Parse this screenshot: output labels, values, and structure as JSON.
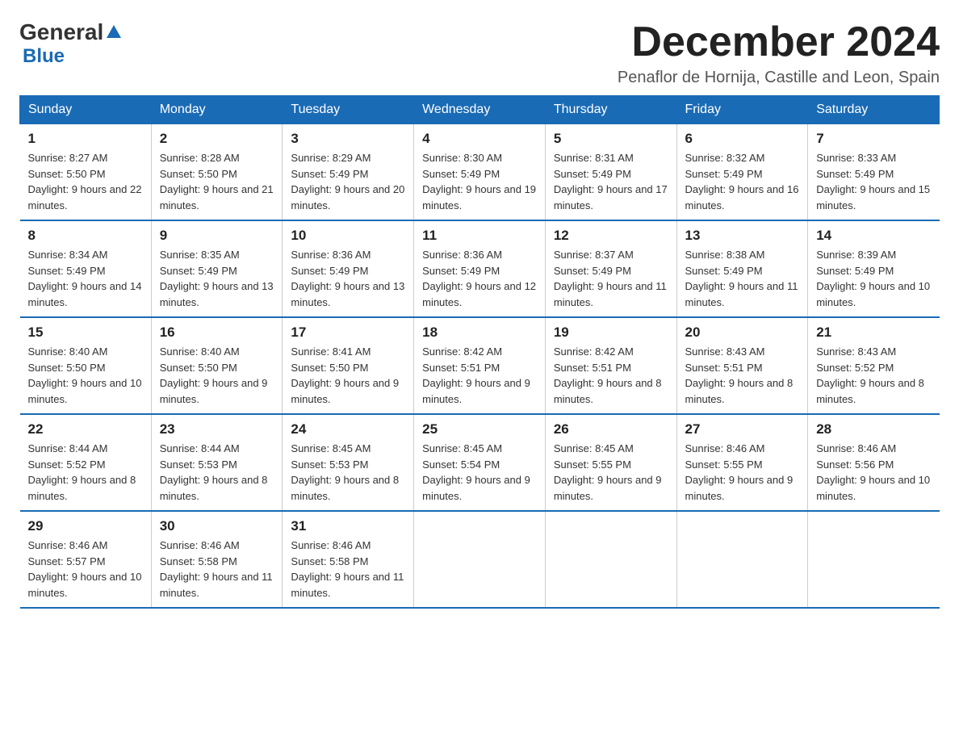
{
  "logo": {
    "general": "General",
    "blue": "Blue"
  },
  "title": {
    "month_year": "December 2024",
    "location": "Penaflor de Hornija, Castille and Leon, Spain"
  },
  "days_of_week": [
    "Sunday",
    "Monday",
    "Tuesday",
    "Wednesday",
    "Thursday",
    "Friday",
    "Saturday"
  ],
  "weeks": [
    [
      {
        "day": "1",
        "sunrise": "Sunrise: 8:27 AM",
        "sunset": "Sunset: 5:50 PM",
        "daylight": "Daylight: 9 hours and 22 minutes."
      },
      {
        "day": "2",
        "sunrise": "Sunrise: 8:28 AM",
        "sunset": "Sunset: 5:50 PM",
        "daylight": "Daylight: 9 hours and 21 minutes."
      },
      {
        "day": "3",
        "sunrise": "Sunrise: 8:29 AM",
        "sunset": "Sunset: 5:49 PM",
        "daylight": "Daylight: 9 hours and 20 minutes."
      },
      {
        "day": "4",
        "sunrise": "Sunrise: 8:30 AM",
        "sunset": "Sunset: 5:49 PM",
        "daylight": "Daylight: 9 hours and 19 minutes."
      },
      {
        "day": "5",
        "sunrise": "Sunrise: 8:31 AM",
        "sunset": "Sunset: 5:49 PM",
        "daylight": "Daylight: 9 hours and 17 minutes."
      },
      {
        "day": "6",
        "sunrise": "Sunrise: 8:32 AM",
        "sunset": "Sunset: 5:49 PM",
        "daylight": "Daylight: 9 hours and 16 minutes."
      },
      {
        "day": "7",
        "sunrise": "Sunrise: 8:33 AM",
        "sunset": "Sunset: 5:49 PM",
        "daylight": "Daylight: 9 hours and 15 minutes."
      }
    ],
    [
      {
        "day": "8",
        "sunrise": "Sunrise: 8:34 AM",
        "sunset": "Sunset: 5:49 PM",
        "daylight": "Daylight: 9 hours and 14 minutes."
      },
      {
        "day": "9",
        "sunrise": "Sunrise: 8:35 AM",
        "sunset": "Sunset: 5:49 PM",
        "daylight": "Daylight: 9 hours and 13 minutes."
      },
      {
        "day": "10",
        "sunrise": "Sunrise: 8:36 AM",
        "sunset": "Sunset: 5:49 PM",
        "daylight": "Daylight: 9 hours and 13 minutes."
      },
      {
        "day": "11",
        "sunrise": "Sunrise: 8:36 AM",
        "sunset": "Sunset: 5:49 PM",
        "daylight": "Daylight: 9 hours and 12 minutes."
      },
      {
        "day": "12",
        "sunrise": "Sunrise: 8:37 AM",
        "sunset": "Sunset: 5:49 PM",
        "daylight": "Daylight: 9 hours and 11 minutes."
      },
      {
        "day": "13",
        "sunrise": "Sunrise: 8:38 AM",
        "sunset": "Sunset: 5:49 PM",
        "daylight": "Daylight: 9 hours and 11 minutes."
      },
      {
        "day": "14",
        "sunrise": "Sunrise: 8:39 AM",
        "sunset": "Sunset: 5:49 PM",
        "daylight": "Daylight: 9 hours and 10 minutes."
      }
    ],
    [
      {
        "day": "15",
        "sunrise": "Sunrise: 8:40 AM",
        "sunset": "Sunset: 5:50 PM",
        "daylight": "Daylight: 9 hours and 10 minutes."
      },
      {
        "day": "16",
        "sunrise": "Sunrise: 8:40 AM",
        "sunset": "Sunset: 5:50 PM",
        "daylight": "Daylight: 9 hours and 9 minutes."
      },
      {
        "day": "17",
        "sunrise": "Sunrise: 8:41 AM",
        "sunset": "Sunset: 5:50 PM",
        "daylight": "Daylight: 9 hours and 9 minutes."
      },
      {
        "day": "18",
        "sunrise": "Sunrise: 8:42 AM",
        "sunset": "Sunset: 5:51 PM",
        "daylight": "Daylight: 9 hours and 9 minutes."
      },
      {
        "day": "19",
        "sunrise": "Sunrise: 8:42 AM",
        "sunset": "Sunset: 5:51 PM",
        "daylight": "Daylight: 9 hours and 8 minutes."
      },
      {
        "day": "20",
        "sunrise": "Sunrise: 8:43 AM",
        "sunset": "Sunset: 5:51 PM",
        "daylight": "Daylight: 9 hours and 8 minutes."
      },
      {
        "day": "21",
        "sunrise": "Sunrise: 8:43 AM",
        "sunset": "Sunset: 5:52 PM",
        "daylight": "Daylight: 9 hours and 8 minutes."
      }
    ],
    [
      {
        "day": "22",
        "sunrise": "Sunrise: 8:44 AM",
        "sunset": "Sunset: 5:52 PM",
        "daylight": "Daylight: 9 hours and 8 minutes."
      },
      {
        "day": "23",
        "sunrise": "Sunrise: 8:44 AM",
        "sunset": "Sunset: 5:53 PM",
        "daylight": "Daylight: 9 hours and 8 minutes."
      },
      {
        "day": "24",
        "sunrise": "Sunrise: 8:45 AM",
        "sunset": "Sunset: 5:53 PM",
        "daylight": "Daylight: 9 hours and 8 minutes."
      },
      {
        "day": "25",
        "sunrise": "Sunrise: 8:45 AM",
        "sunset": "Sunset: 5:54 PM",
        "daylight": "Daylight: 9 hours and 9 minutes."
      },
      {
        "day": "26",
        "sunrise": "Sunrise: 8:45 AM",
        "sunset": "Sunset: 5:55 PM",
        "daylight": "Daylight: 9 hours and 9 minutes."
      },
      {
        "day": "27",
        "sunrise": "Sunrise: 8:46 AM",
        "sunset": "Sunset: 5:55 PM",
        "daylight": "Daylight: 9 hours and 9 minutes."
      },
      {
        "day": "28",
        "sunrise": "Sunrise: 8:46 AM",
        "sunset": "Sunset: 5:56 PM",
        "daylight": "Daylight: 9 hours and 10 minutes."
      }
    ],
    [
      {
        "day": "29",
        "sunrise": "Sunrise: 8:46 AM",
        "sunset": "Sunset: 5:57 PM",
        "daylight": "Daylight: 9 hours and 10 minutes."
      },
      {
        "day": "30",
        "sunrise": "Sunrise: 8:46 AM",
        "sunset": "Sunset: 5:58 PM",
        "daylight": "Daylight: 9 hours and 11 minutes."
      },
      {
        "day": "31",
        "sunrise": "Sunrise: 8:46 AM",
        "sunset": "Sunset: 5:58 PM",
        "daylight": "Daylight: 9 hours and 11 minutes."
      },
      {
        "day": "",
        "sunrise": "",
        "sunset": "",
        "daylight": ""
      },
      {
        "day": "",
        "sunrise": "",
        "sunset": "",
        "daylight": ""
      },
      {
        "day": "",
        "sunrise": "",
        "sunset": "",
        "daylight": ""
      },
      {
        "day": "",
        "sunrise": "",
        "sunset": "",
        "daylight": ""
      }
    ]
  ]
}
